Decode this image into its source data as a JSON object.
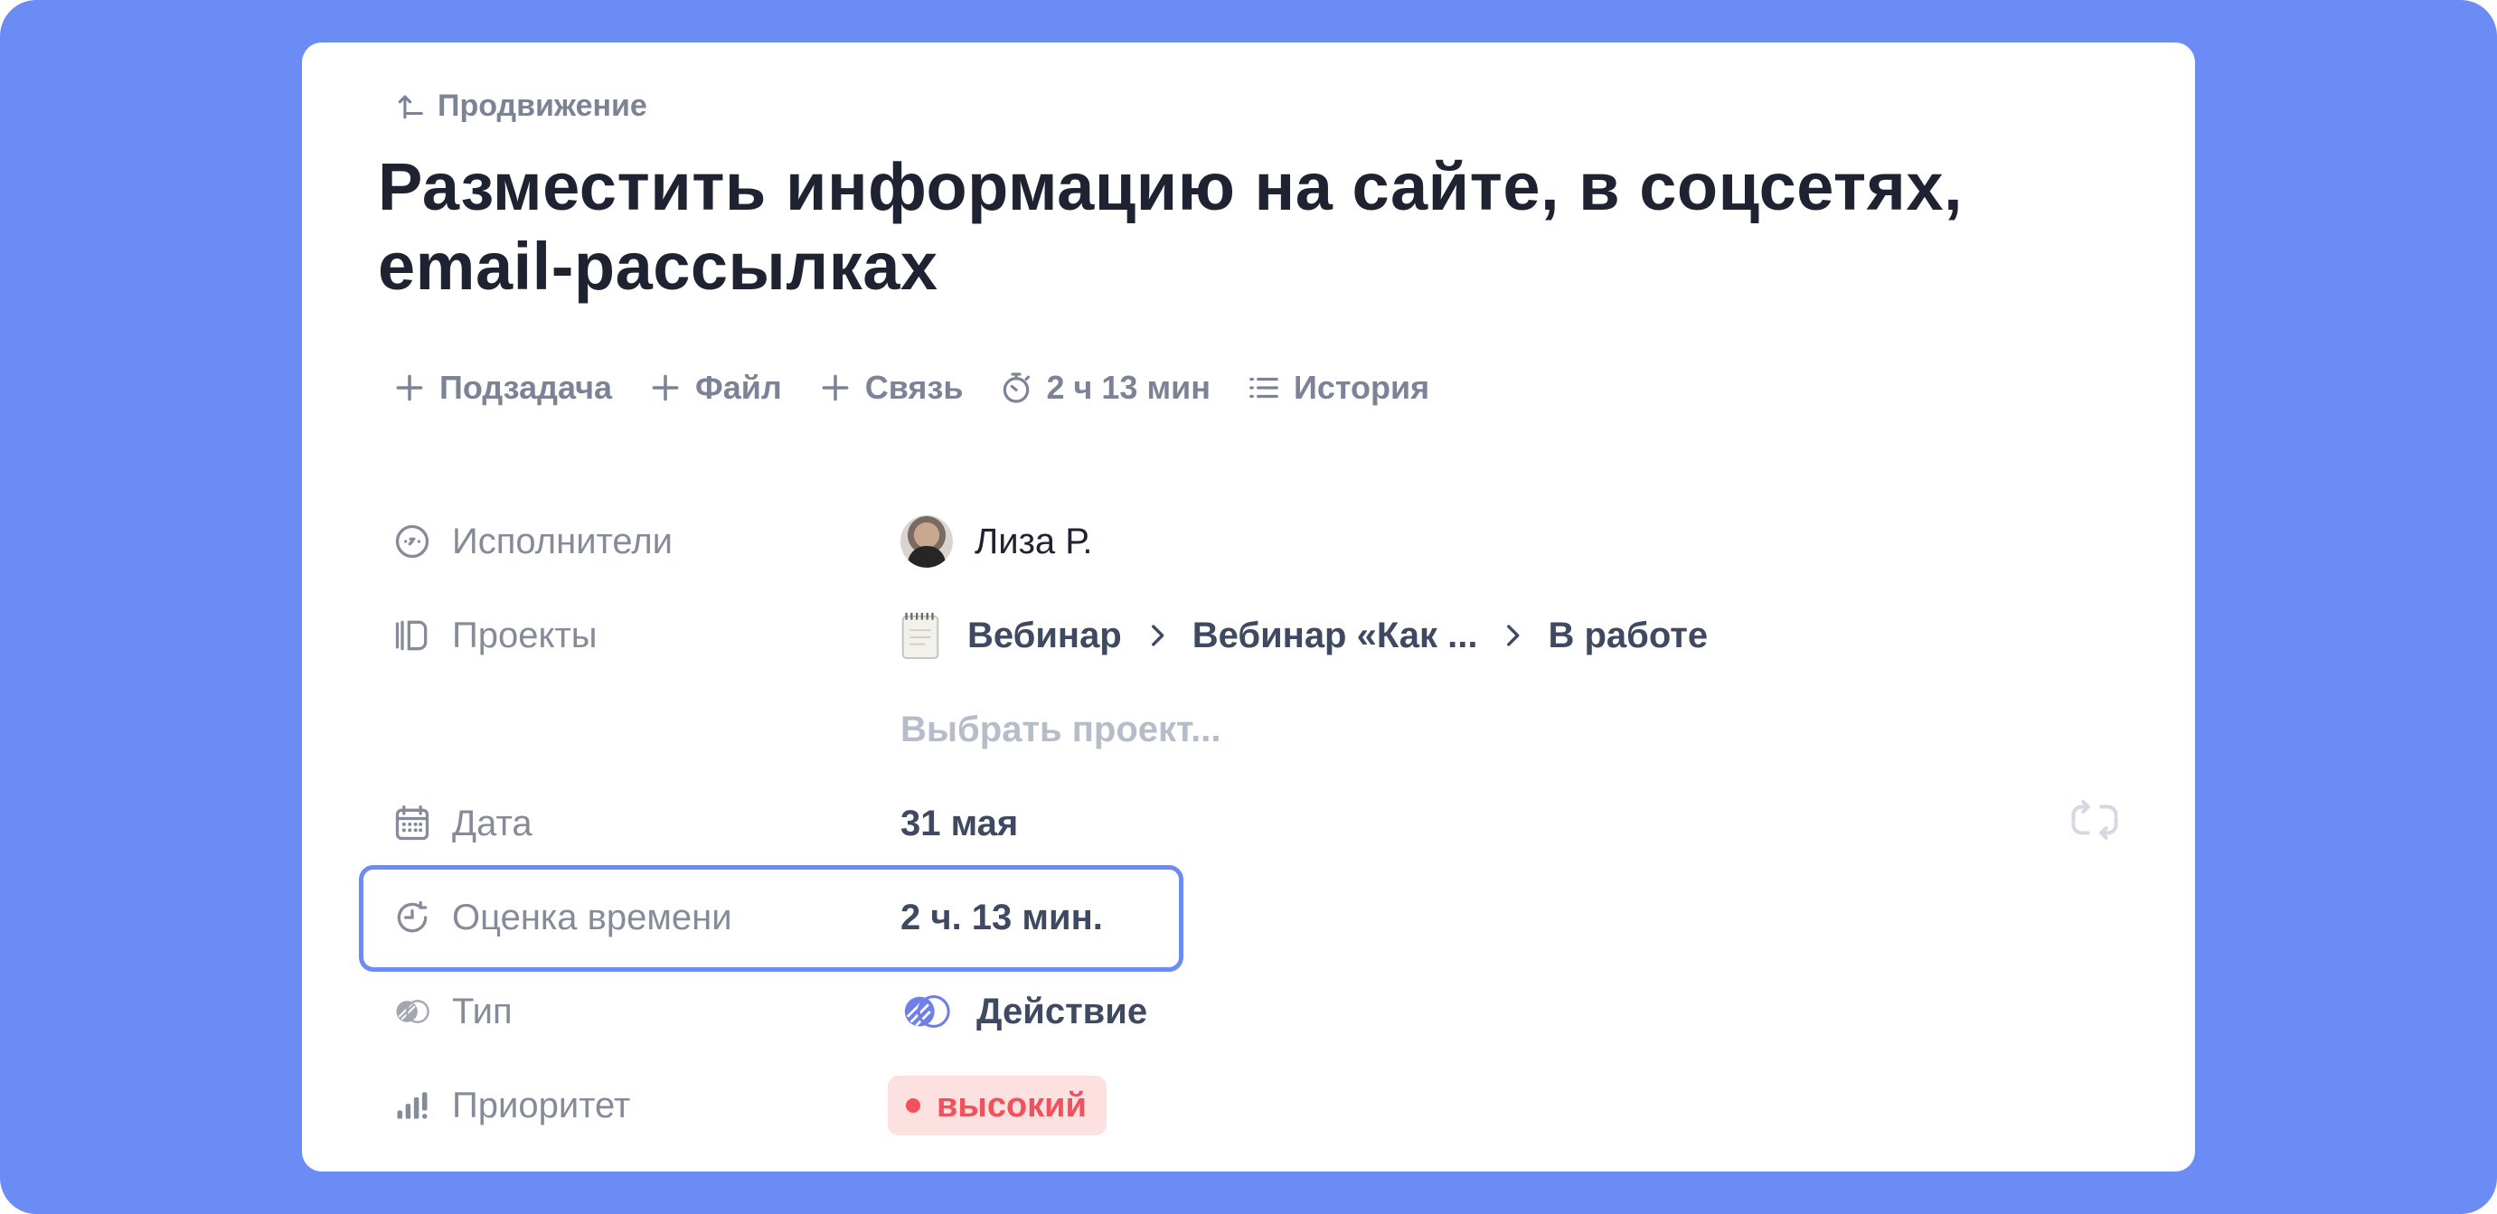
{
  "breadcrumb": {
    "parent": "Продвижение"
  },
  "task": {
    "title": "Разместить информацию на сайте, в соцсетях, email-рассылках"
  },
  "actions": {
    "subtask": "Подзадача",
    "file": "Файл",
    "link": "Связь",
    "timer": "2 ч 13 мин",
    "history": "История"
  },
  "fields": {
    "assignees": {
      "label": "Исполнители",
      "value": "Лиза Р."
    },
    "projects": {
      "label": "Проекты",
      "path": [
        "Вебинар",
        "Вебинар «Как ...",
        "В работе"
      ],
      "choose": "Выбрать проект..."
    },
    "date": {
      "label": "Дата",
      "value": "31 мая"
    },
    "estimate": {
      "label": "Оценка времени",
      "value": "2 ч. 13 мин."
    },
    "type": {
      "label": "Тип",
      "value": "Действие"
    },
    "priority": {
      "label": "Приоритет",
      "value": "высокий"
    }
  },
  "colors": {
    "frame": "#6b8cf4",
    "priority_high": "#f1505c",
    "priority_bg": "#fde0e0",
    "type_accent": "#6f7fe8"
  },
  "icons": {
    "breadcrumb": "return-up-icon",
    "subtask": "plus-icon",
    "file": "plus-icon",
    "link": "plus-icon",
    "timer": "stopwatch-icon",
    "history": "list-icon",
    "assignees": "assignee-icon",
    "projects": "projects-icon",
    "date": "calendar-icon",
    "estimate": "clock-estimate-icon",
    "type": "type-icon",
    "priority": "priority-bars-icon",
    "repeat": "repeat-icon"
  }
}
